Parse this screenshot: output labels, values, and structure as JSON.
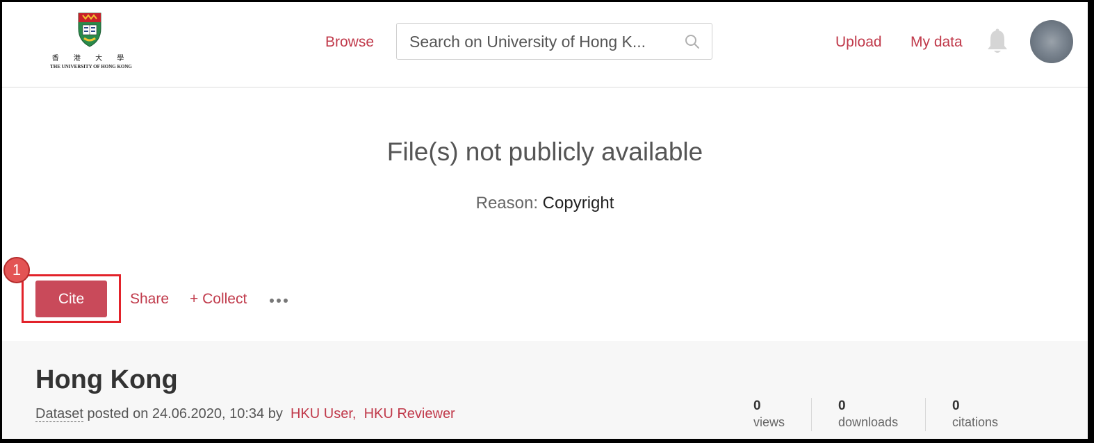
{
  "header": {
    "logo": {
      "chinese": "香 港 大 學",
      "english": "THE UNIVERSITY OF HONG KONG"
    },
    "nav": {
      "browse": "Browse",
      "upload": "Upload",
      "my_data": "My data"
    },
    "search": {
      "placeholder": "Search on University of Hong K..."
    }
  },
  "notice": {
    "title": "File(s) not publicly available",
    "reason_label": "Reason:",
    "reason_value": "Copyright"
  },
  "actions": {
    "step_number": "1",
    "cite": "Cite",
    "share": "Share",
    "collect": "+ Collect"
  },
  "dataset": {
    "title": "Hong Kong",
    "type": "Dataset",
    "posted_text": "posted on 24.06.2020, 10:34 by",
    "authors": [
      "HKU User,",
      "HKU Reviewer"
    ],
    "stats": [
      {
        "value": "0",
        "label": "views"
      },
      {
        "value": "0",
        "label": "downloads"
      },
      {
        "value": "0",
        "label": "citations"
      }
    ]
  },
  "colors": {
    "accent": "#c0394a",
    "cite_button": "#c94a5a",
    "highlight": "#e2222a"
  }
}
